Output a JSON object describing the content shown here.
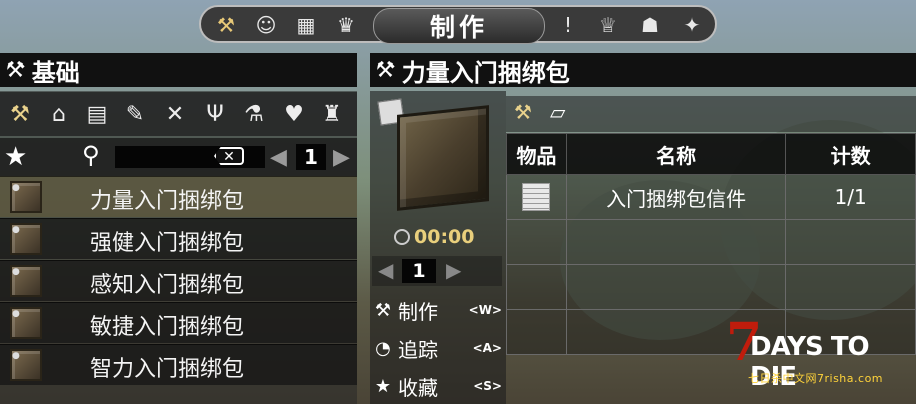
{
  "top_tabs": {
    "active_label": "制作",
    "icons": [
      "hammer-icon",
      "character-icon",
      "map-icon",
      "skills-icon",
      "quest-icon",
      "trophy-icon",
      "players-icon",
      "lightbulb-icon"
    ]
  },
  "category_panel": {
    "title": "基础",
    "categories": [
      "hammer-icon",
      "house-icon",
      "building-icon",
      "weapon-icon",
      "tools-icon",
      "fork-icon",
      "microscope-icon",
      "armor-icon",
      "chair-icon"
    ],
    "search_placeholder": "",
    "page_number": "1"
  },
  "recipes": [
    {
      "label": "力量入门捆绑包"
    },
    {
      "label": "强健入门捆绑包"
    },
    {
      "label": "感知入门捆绑包"
    },
    {
      "label": "敏捷入门捆绑包"
    },
    {
      "label": "智力入门捆绑包"
    }
  ],
  "detail": {
    "title": "力量入门捆绑包",
    "craft_time": "00:00",
    "quantity": "1",
    "actions": [
      {
        "label": "制作",
        "key": "<W>",
        "icon": "hammer-icon"
      },
      {
        "label": "追踪",
        "key": "<A>",
        "icon": "compass-icon"
      },
      {
        "label": "收藏",
        "key": "<S>",
        "icon": "star-icon"
      }
    ],
    "ingredients_table": {
      "headers": [
        "物品",
        "名称",
        "计数"
      ],
      "rows": [
        {
          "name": "入门捆绑包信件",
          "count": "1/1"
        }
      ]
    }
  },
  "watermark": {
    "logo_text": "DAYS TO DIE",
    "logo_number": "7",
    "sub": "七日杀中文网7risha.com"
  }
}
